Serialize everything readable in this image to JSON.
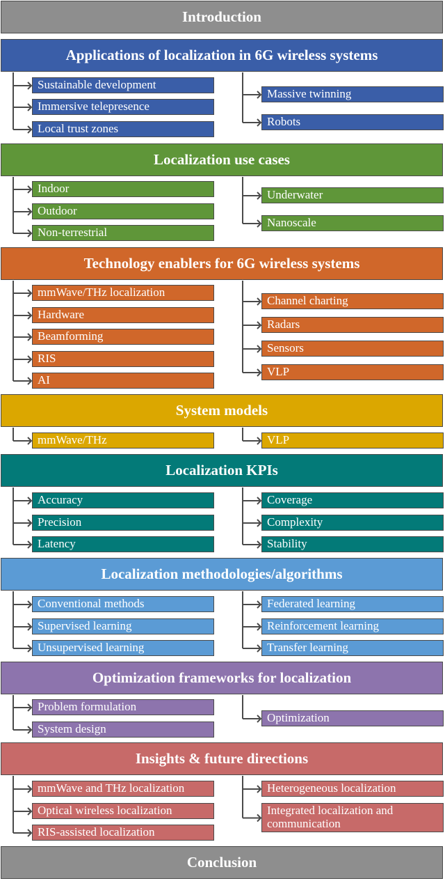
{
  "colors": {
    "gray": "#8e8e8e",
    "blue": "#3a5ea8",
    "green": "#5f9639",
    "orange": "#d0672a",
    "gold": "#dba700",
    "teal": "#037a78",
    "lightblue": "#5b9bd5",
    "purple": "#8d74ad",
    "red": "#c76a69",
    "connector": "#4a4a4a"
  },
  "intro": "Introduction",
  "conclusion": "Conclusion",
  "sections": [
    {
      "title": "Applications of localization in 6G wireless systems",
      "color": "blue",
      "left": [
        "Sustainable development",
        "Immersive telepresence",
        "Local trust zones"
      ],
      "right": [
        "Massive twinning",
        "Robots"
      ]
    },
    {
      "title": "Localization use cases",
      "color": "green",
      "left": [
        "Indoor",
        "Outdoor",
        "Non-terrestrial"
      ],
      "right": [
        "Underwater",
        "Nanoscale"
      ]
    },
    {
      "title": "Technology enablers for 6G wireless systems",
      "color": "orange",
      "left": [
        "mmWave/THz localization",
        "Hardware",
        "Beamforming",
        "RIS",
        "AI"
      ],
      "right": [
        "Channel charting",
        "Radars",
        "Sensors",
        "VLP"
      ]
    },
    {
      "title": "System models",
      "color": "gold",
      "left": [
        "mmWave/THz"
      ],
      "right": [
        "VLP"
      ]
    },
    {
      "title": "Localization KPIs",
      "color": "teal",
      "left": [
        "Accuracy",
        "Precision",
        "Latency"
      ],
      "right": [
        "Coverage",
        "Complexity",
        "Stability"
      ]
    },
    {
      "title": "Localization methodologies/algorithms",
      "color": "lightblue",
      "left": [
        "Conventional methods",
        "Supervised learning",
        "Unsupervised learning"
      ],
      "right": [
        "Federated learning",
        "Reinforcement learning",
        "Transfer learning"
      ]
    },
    {
      "title": "Optimization frameworks for localization",
      "color": "purple",
      "left": [
        "Problem formulation",
        "System design"
      ],
      "right": [
        "Optimization"
      ]
    },
    {
      "title": "Insights & future directions",
      "color": "red",
      "left": [
        "mmWave and THz localization",
        "Optical wireless localization",
        "RIS-assisted localization"
      ],
      "right": [
        "Heterogeneous localization",
        "Integrated localization and communication"
      ]
    }
  ]
}
